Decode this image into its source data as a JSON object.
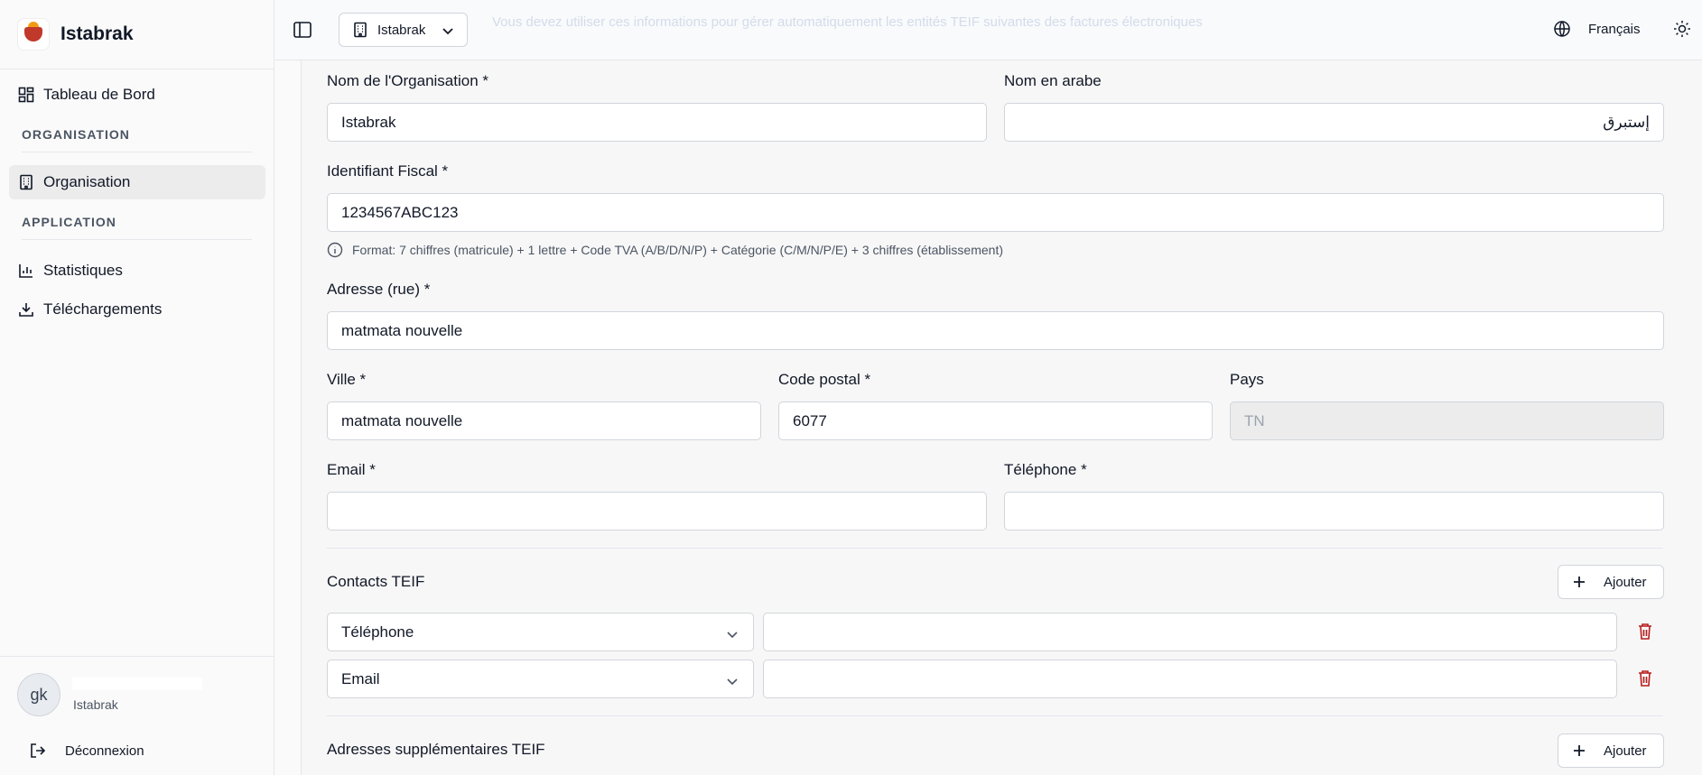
{
  "app": {
    "name": "Istabrak"
  },
  "sidebar": {
    "dashboard_label": "Tableau de Bord",
    "section_org": "ORGANISATION",
    "organisation_label": "Organisation",
    "section_app": "APPLICATION",
    "stats_label": "Statistiques",
    "downloads_label": "Téléchargements"
  },
  "user": {
    "initials": "gk",
    "org": "Istabrak",
    "logout_label": "Déconnexion"
  },
  "header": {
    "org_select": "Istabrak",
    "banner_text": "Vous devez utiliser ces informations pour gérer automatiquement les entités TEIF suivantes des factures électroniques",
    "language": "Français"
  },
  "form": {
    "org_name_label": "Nom de l'Organisation *",
    "org_name_value": "Istabrak",
    "arabic_name_label": "Nom en arabe",
    "arabic_name_value": "إستبرق",
    "tax_id_label": "Identifiant Fiscal *",
    "tax_id_value": "1234567ABC123",
    "tax_id_hint": "Format: 7 chiffres (matricule) + 1 lettre + Code TVA (A/B/D/N/P) + Catégorie (C/M/N/P/E) + 3 chiffres (établissement)",
    "address_label": "Adresse (rue) *",
    "address_value": "matmata nouvelle",
    "city_label": "Ville *",
    "city_value": "matmata nouvelle",
    "postal_label": "Code postal *",
    "postal_value": "6077",
    "country_label": "Pays",
    "country_value": "TN",
    "email_label": "Email *",
    "phone_label": "Téléphone *"
  },
  "contacts": {
    "title": "Contacts TEIF",
    "add_label": "Ajouter",
    "rows": [
      {
        "type": "Téléphone"
      },
      {
        "type": "Email"
      }
    ]
  },
  "addresses": {
    "title": "Adresses supplémentaires TEIF",
    "add_label": "Ajouter"
  },
  "colors": {
    "danger": "#b91c1c",
    "accent": "#111827"
  }
}
